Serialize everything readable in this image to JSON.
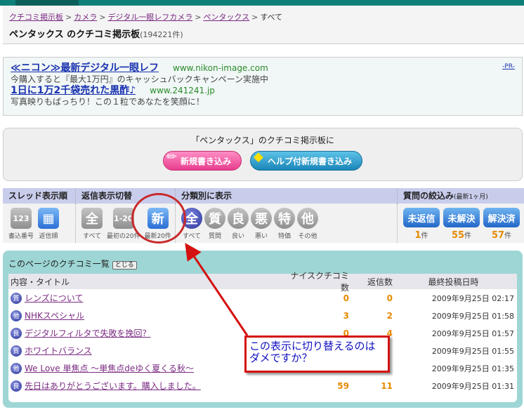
{
  "breadcrumb": [
    "クチコミ掲示板",
    "カメラ",
    "デジタル一眼レフカメラ",
    "ペンタックス",
    "すべて"
  ],
  "breadcrumb_sep": ">",
  "title": "ペンタックス のクチコミ掲示板",
  "count": "(194221件)",
  "ads": {
    "pr": "-PR-",
    "items": [
      {
        "headline": "≪ニコン≫最新デジタル一眼レフ",
        "url": "www.nikon-image.com",
        "desc": "今購入すると『最大1万円』のキャッシュバックキャンペーン実施中"
      },
      {
        "headline": "1日に1万2千袋売れた黒酢♪",
        "url": "www.241241.jp",
        "desc": "写真映りもばっちり！この１粒であなたを笑顔に！"
      }
    ]
  },
  "post": {
    "label": "「ペンタックス」のクチコミ掲示板に",
    "new_button": "新規書き込み",
    "help_button": "ヘルプ付新規書き込み"
  },
  "filter": {
    "thread_order": {
      "title": "スレッド表示順",
      "items": [
        {
          "icon": "123",
          "cap": "書込番号"
        },
        {
          "icon": "▦",
          "cap": "返信順"
        }
      ]
    },
    "reply_view": {
      "title": "返信表示切替",
      "items": [
        {
          "icon": "全",
          "cap": "すべて"
        },
        {
          "icon": "1-20",
          "cap": "最初の20件"
        },
        {
          "icon": "新",
          "cap": "最新20件"
        }
      ]
    },
    "category": {
      "title": "分類別に表示",
      "items": [
        {
          "icon": "全",
          "cap": "すべて"
        },
        {
          "icon": "質",
          "cap": "質問"
        },
        {
          "icon": "良",
          "cap": "良い"
        },
        {
          "icon": "悪",
          "cap": "悪い"
        },
        {
          "icon": "特",
          "cap": "特価"
        },
        {
          "icon": "他",
          "cap": "その他"
        }
      ]
    },
    "question": {
      "title": "質問の絞込み",
      "sub": "(最新1ヶ月)",
      "unit": "件",
      "items": [
        {
          "label": "未返信",
          "count": "1"
        },
        {
          "label": "未解決",
          "count": "55"
        },
        {
          "label": "解決済",
          "count": "57"
        }
      ]
    }
  },
  "list": {
    "title": "このページのクチコミ一覧",
    "close": "とじる",
    "headers": [
      "内容・タイトル",
      "ナイスクチコミ数",
      "返信数",
      "最終投稿日時"
    ],
    "rows": [
      {
        "cat": "質",
        "title": "レンズについて",
        "nice": "0",
        "replies": "0",
        "date": "2009年9月25日 02:17"
      },
      {
        "cat": "他",
        "title": "NHKスペシャル",
        "nice": "3",
        "replies": "2",
        "date": "2009年9月25日 01:58"
      },
      {
        "cat": "良",
        "title": "デジタルフィルタで失敗を挽回？",
        "nice": "0",
        "replies": "4",
        "date": "2009年9月25日 01:57"
      },
      {
        "cat": "質",
        "title": "ホワイトバランス",
        "nice": "",
        "replies": "",
        "date": "2009年9月25日 01:55"
      },
      {
        "cat": "他",
        "title": "We Love 単焦点 ～単焦点deゆく夏くる秋～",
        "nice": "",
        "replies": "",
        "date": "2009年9月25日 01:35"
      },
      {
        "cat": "良",
        "title": "先日はありがとうございます。購入しました。",
        "nice": "59",
        "replies": "11",
        "date": "2009年9月25日 01:31"
      }
    ]
  },
  "annotation": {
    "note": "この表示に切り替えるのはダメですか？"
  }
}
